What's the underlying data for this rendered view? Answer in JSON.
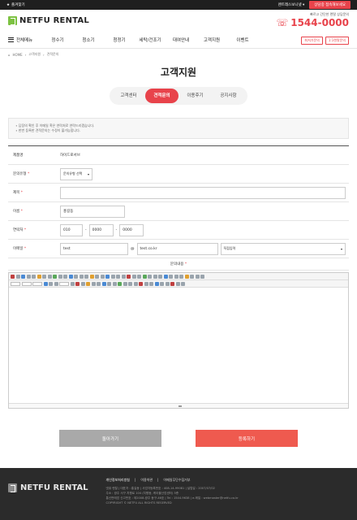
{
  "topbar": {
    "favorite": "즐겨찾기",
    "guide": "렌트레스보니넷 ▾",
    "cta": "상담중 접속해보세요"
  },
  "header": {
    "logo": "NETFU RENTAL",
    "phone_note": "빠르고 간단한 렌탈 상담문의",
    "phone": "1544-0000"
  },
  "nav": {
    "all_menu": "전체메뉴",
    "items": [
      "정수기",
      "청소기",
      "청정기",
      "세탁/건조기",
      "대여안내",
      "고객지원",
      "이벤트"
    ],
    "buttons": [
      "최저가문의",
      "1:1렌탈문의"
    ]
  },
  "breadcrumb": [
    "HOME",
    "고객지원",
    "견적문의"
  ],
  "page_title": "고객지원",
  "tabs": [
    "고객센터",
    "견적문의",
    "이용후기",
    "공지사항"
  ],
  "notice": [
    "∙ 답장의 확인 후 이메일 혹은 연락처로 연락드리겠습니다.",
    "∙ 한번 등록한 견적문의는 수정이 불가능합니다."
  ],
  "form": {
    "product_label": "제품명",
    "product_value": "하이드로서브",
    "type_label": "문의유형",
    "type_value": "문의유형 선택",
    "subject_label": "제목",
    "name_label": "이름",
    "name_value": "홍길동",
    "phone_label": "연락처",
    "phone1": "010",
    "phone2": "0000",
    "phone3": "0000",
    "email_label": "이메일",
    "email_id": "test",
    "email_domain": "test.co.kr",
    "email_select": "직접입력",
    "content_label": "문의내용",
    "sep_dash": "-",
    "at": "@"
  },
  "buttons": {
    "back": "돌아가기",
    "submit": "등록하기"
  },
  "footer": {
    "logo": "NETFU RENTAL",
    "links": [
      "개인정보처리방침",
      "이용약관",
      "이메일무단수집거부"
    ],
    "info": [
      "넷퓨 렌탈 | 대표자 : 홍길동 | 사업자등록번호 : 408-14-99081 | 설립일 : 2007/07/02",
      "주소 : 광주 서구 치평로 104 (치평동, 케이블산업센터) 5층",
      "통신판매업 신고번호 : 제2008-광주 동구-46호 | Tel : 1544-9638 | e-메일 : webmaster@netfu.co.kr",
      "COPYRIGHT © NETFU ALL RIGHTS RESERVED"
    ]
  }
}
